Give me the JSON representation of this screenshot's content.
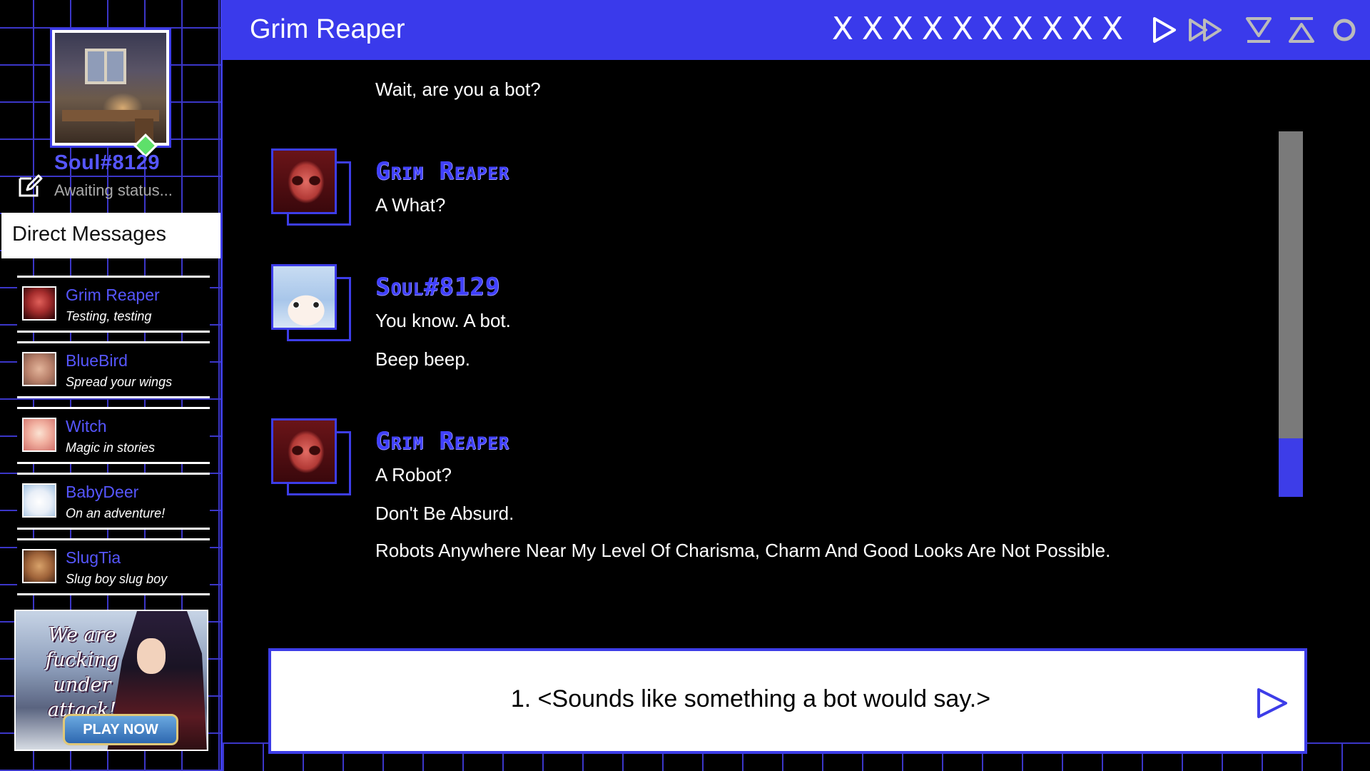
{
  "profile": {
    "name": "Soul#8129",
    "status": "Awaiting status..."
  },
  "sidebar": {
    "dm_header": "Direct Messages",
    "contacts": [
      {
        "name": "Grim Reaper",
        "status": "Testing, testing"
      },
      {
        "name": "BlueBird",
        "status": "Spread your wings"
      },
      {
        "name": "Witch",
        "status": "Magic in stories"
      },
      {
        "name": "BabyDeer",
        "status": "On an adventure!"
      },
      {
        "name": "SlugTia",
        "status": "Slug boy slug boy"
      }
    ],
    "ad": {
      "text": "We are fucking under attack!",
      "button": "PLAY NOW"
    }
  },
  "topbar": {
    "title": "Grim Reaper",
    "skip_marks": [
      "X",
      "X",
      "X",
      "X",
      "X",
      "X",
      "X",
      "X",
      "X",
      "X"
    ],
    "icons": [
      "play-icon",
      "fast-forward-icon",
      "save-icon",
      "load-icon",
      "settings-circle-icon"
    ]
  },
  "chat": {
    "messages": [
      {
        "speaker": "",
        "lines": [
          "Wait, are you a bot?"
        ]
      },
      {
        "speaker": "Grim Reaper",
        "lines": [
          "A What?"
        ]
      },
      {
        "speaker": "Soul#8129",
        "lines": [
          "You know. A bot.",
          "Beep beep."
        ]
      },
      {
        "speaker": "Grim Reaper",
        "lines": [
          "A Robot?",
          "Don't Be Absurd.",
          "Robots Anywhere Near My Level Of Charisma, Charm And Good Looks Are Not Possible."
        ]
      }
    ],
    "scroll_position": 0.16
  },
  "choice": {
    "text": "1. <Sounds like something a bot would say.>"
  },
  "colors": {
    "accent": "#3a3aeb",
    "name_blue": "#5656ff",
    "online": "#5ee06a"
  }
}
